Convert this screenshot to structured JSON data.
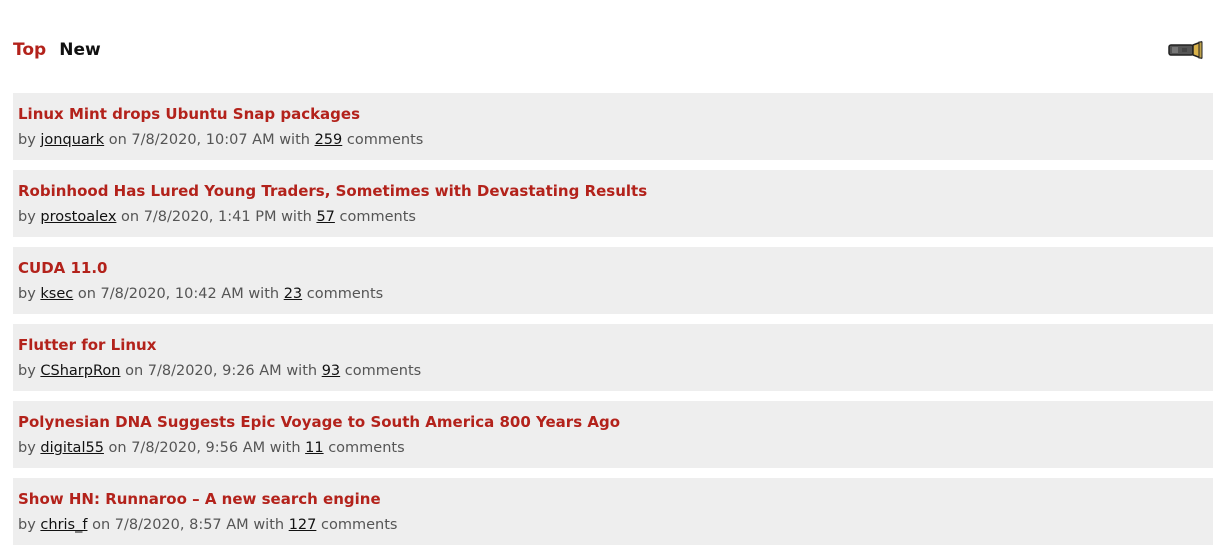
{
  "nav": {
    "top_label": "Top",
    "new_label": "New",
    "flashlight_icon": "flashlight-icon"
  },
  "colors": {
    "accent": "#b3221b",
    "item_bg": "#eeeeee",
    "meta_text": "#555555"
  },
  "meta_words": {
    "by": "by",
    "on": "on",
    "with": "with",
    "comments": "comments"
  },
  "stories": [
    {
      "title": "Linux Mint drops Ubuntu Snap packages",
      "author": "jonquark",
      "date": "7/8/2020, 10:07 AM",
      "comments": "259"
    },
    {
      "title": "Robinhood Has Lured Young Traders, Sometimes with Devastating Results",
      "author": "prostoalex",
      "date": "7/8/2020, 1:41 PM",
      "comments": "57"
    },
    {
      "title": "CUDA 11.0",
      "author": "ksec",
      "date": "7/8/2020, 10:42 AM",
      "comments": "23"
    },
    {
      "title": "Flutter for Linux",
      "author": "CSharpRon",
      "date": "7/8/2020, 9:26 AM",
      "comments": "93"
    },
    {
      "title": "Polynesian DNA Suggests Epic Voyage to South America 800 Years Ago",
      "author": "digital55",
      "date": "7/8/2020, 9:56 AM",
      "comments": "11"
    },
    {
      "title": "Show HN: Runnaroo – A new search engine",
      "author": "chris_f",
      "date": "7/8/2020, 8:57 AM",
      "comments": "127"
    }
  ]
}
